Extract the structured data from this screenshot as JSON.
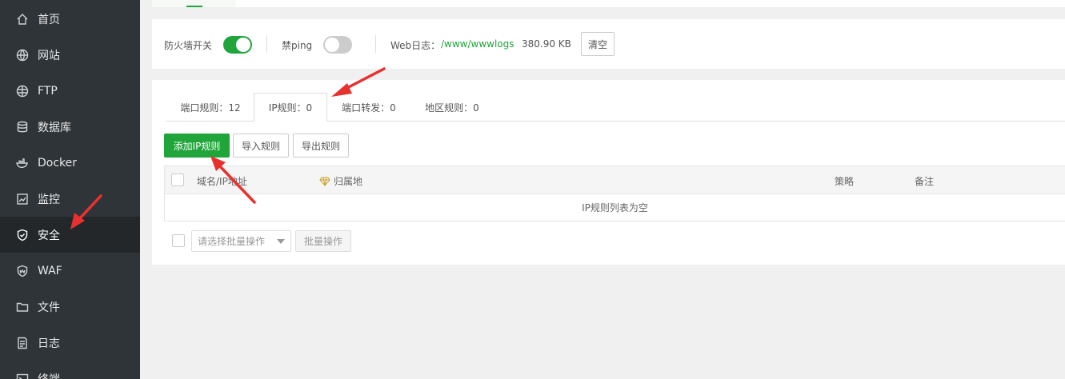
{
  "sidebar": {
    "items": [
      {
        "label": "首页",
        "icon": "home-icon"
      },
      {
        "label": "网站",
        "icon": "globe-icon"
      },
      {
        "label": "FTP",
        "icon": "ftp-globe-icon"
      },
      {
        "label": "数据库",
        "icon": "database-icon"
      },
      {
        "label": "Docker",
        "icon": "docker-icon"
      },
      {
        "label": "监控",
        "icon": "monitor-chart-icon"
      },
      {
        "label": "安全",
        "icon": "shield-check-icon",
        "active": true
      },
      {
        "label": "WAF",
        "icon": "waf-shield-icon"
      },
      {
        "label": "文件",
        "icon": "folder-icon"
      },
      {
        "label": "日志",
        "icon": "log-document-icon"
      },
      {
        "label": "终端",
        "icon": "terminal-icon"
      }
    ]
  },
  "controls": {
    "firewall_label": "防火墙开关",
    "firewall_on": true,
    "ping_label": "禁ping",
    "ping_on": false,
    "weblog_label": "Web日志：",
    "weblog_path": "/www/wwwlogs",
    "weblog_size": "380.90 KB",
    "clear_button": "清空"
  },
  "tabs": [
    {
      "label": "端口规则：12",
      "active": false
    },
    {
      "label": "IP规则：0",
      "active": true
    },
    {
      "label": "端口转发：0",
      "active": false
    },
    {
      "label": "地区规则：0",
      "active": false
    }
  ],
  "toolbar": {
    "add_ip_rule": "添加IP规则",
    "import_rules": "导入规则",
    "export_rules": "导出规则"
  },
  "table": {
    "columns": {
      "address": "域名/IP地址",
      "location": "归属地",
      "strategy": "策略",
      "remark": "备注"
    },
    "empty_text": "IP规则列表为空"
  },
  "batch": {
    "select_placeholder": "请选择批量操作",
    "batch_button": "批量操作"
  },
  "colors": {
    "accent": "#20a53a",
    "sidebar_bg": "#2f3438",
    "annotation_arrow": "#e8312f"
  }
}
